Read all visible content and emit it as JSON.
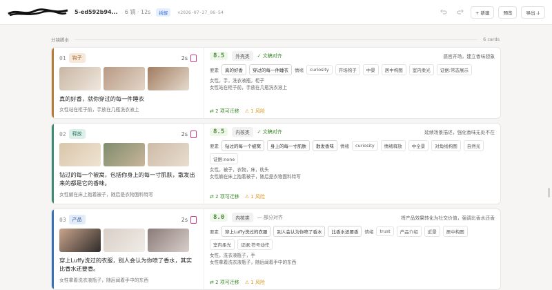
{
  "topbar": {
    "project_id": "5-ed592b94...",
    "meta": "6 镜 · 12s",
    "badge": "拆解",
    "version": "v2026-07-27_06-54",
    "undo_icon": "undo-icon",
    "redo_icon": "redo-icon",
    "new_label": "+ 新建",
    "preview_label": "预览",
    "export_label": "导出 ↓"
  },
  "section": {
    "title": "分镜脚本",
    "count": "6 cards"
  },
  "cards": [
    {
      "num": "01",
      "type": "钩子",
      "duration": "2s",
      "caption": "真的好香，就你穿过的每一件睡衣",
      "sub": "女性站在柜子前，手放在几瓶洗衣液上",
      "score": "8.5",
      "category": "外壳类",
      "align": "✓ 文稿对齐",
      "note": "感官开场，建立香味想象",
      "elem_label": "要素",
      "elements": [
        "真的好香",
        "穿过的每一件睡衣"
      ],
      "emo_label": "情绪",
      "emotions": [
        "curiosity",
        "开场钩子",
        "中景",
        "居中构图",
        "室内柔光",
        "证据:常态展示"
      ],
      "desc1": "女性，手，洗衣液瓶，柜子",
      "desc2": "女性站在柜子前，手放在几瓶洗衣液上",
      "migrate": "⇄ 2 项可迁移",
      "risk": "⚠ 1 风险",
      "accent": "#b57a3e",
      "type_bg": "#f7e9da",
      "type_fg": "#a0622b"
    },
    {
      "num": "02",
      "type": "释放",
      "duration": "2s",
      "caption": "钻过的每一个被窝，包括你身上的每一寸肌肤，散发出来的都是它的香味。",
      "sub": "女性躺在床上抱着被子，随后是衣物面料特写",
      "score": "8.5",
      "category": "内核类",
      "align": "✓ 文稿对齐",
      "note": "延续场景描述，强化香味无处不在",
      "elem_label": "要素",
      "elements": [
        "钻过的每一个被窝",
        "身上的每一寸肌肤",
        "散发香味"
      ],
      "emo_label": "情绪",
      "emotions": [
        "curiosity",
        "情绪释放",
        "中全景",
        "对角线构图",
        "自然光",
        "证据:none"
      ],
      "desc1": "女性，被子，衣物，床，枕头",
      "desc2": "女性躺在床上抱着被子，随后是衣物面料特写",
      "migrate": "⇄ 2 项可迁移",
      "risk": "⚠ 1 风险",
      "accent": "#3f8a74",
      "type_bg": "#dcefe8",
      "type_fg": "#2e7a63"
    },
    {
      "num": "03",
      "type": "产品",
      "duration": "2s",
      "caption": "穿上Luffy洗过的衣服，别人会认为你喷了香水，其实比香水还要香。",
      "sub": "女性拿着洗衣液瓶子，随后闻着手中的东西",
      "score": "8.0",
      "category": "内核类",
      "align": "— 部分对齐",
      "note": "将产品效果转化为社交价值，强调比香水还香",
      "elem_label": "要素",
      "elements": [
        "穿上Luffy洗过的衣服",
        "别人会认为你喷了香水",
        "比香水还要香"
      ],
      "emo_label": "情绪",
      "emotions": [
        "trust",
        "产品介绍",
        "近景",
        "居中构图",
        "室内柔光",
        "证据:符号动作"
      ],
      "desc1": "女性，洗衣液瓶子，手",
      "desc2": "女性拿着洗衣液瓶子，随后闻着手中的东西",
      "migrate": "⇄ 2 项可迁移",
      "risk": "⚠ 1 风险",
      "accent": "#3a6fb0",
      "type_bg": "#e2ebf8",
      "type_fg": "#345f9d"
    }
  ]
}
